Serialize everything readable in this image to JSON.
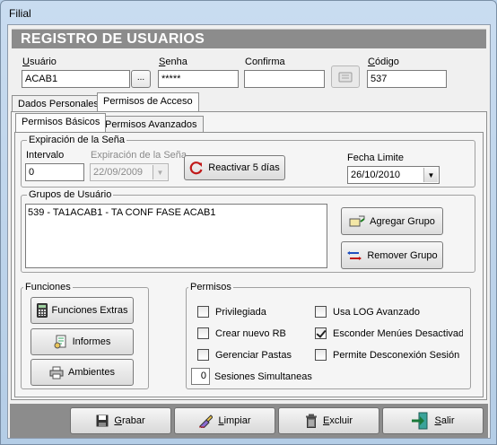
{
  "window": {
    "title": "Filial"
  },
  "header": {
    "title": "REGISTRO DE USUARIOS"
  },
  "fields": {
    "usuario": {
      "label_u": "U",
      "label_rest": "suário",
      "value": "ACAB1",
      "lookup_label": "..."
    },
    "senha": {
      "label_u": "S",
      "label_rest": "enha",
      "value": "*****"
    },
    "confirma": {
      "label": "Confirma",
      "value": ""
    },
    "codigo": {
      "label_u": "C",
      "label_rest": "ódigo",
      "value": "537"
    }
  },
  "tabs": {
    "main": [
      "Dados Personales",
      "Permisos de Acceso"
    ],
    "sub": [
      "Permisos Básicos",
      "Permisos Avanzados"
    ]
  },
  "expiracion": {
    "title": "Expiración de la Seña",
    "intervalo_label": "Intervalo",
    "intervalo_value": "0",
    "fecha_label": "Expiración de la Seña",
    "fecha_value": "22/09/2009",
    "reactivar_label": "Reactivar 5 días",
    "limite_label": "Fecha Limite",
    "limite_value": "26/10/2010"
  },
  "grupos": {
    "title": "Grupos de Usuário",
    "items": [
      "539 - TA1ACAB1 - TA CONF FASE ACAB1"
    ],
    "agregar_label": "Agregar Grupo",
    "remover_label": "Remover Grupo"
  },
  "funciones": {
    "title": "Funciones",
    "buttons": [
      "Funciones Extras",
      "Informes",
      "Ambientes"
    ]
  },
  "permisos": {
    "title": "Permisos",
    "checkboxes": [
      {
        "label": "Privilegiada",
        "checked": false
      },
      {
        "label": "Crear nuevo RB",
        "checked": false
      },
      {
        "label": "Gerenciar Pastas",
        "checked": false
      },
      {
        "label": "Usa LOG Avanzado",
        "checked": false
      },
      {
        "label": "Esconder Menúes Desactivado",
        "checked": true
      },
      {
        "label": "Permite Desconexión Sesión",
        "checked": false
      }
    ],
    "sesiones_value": "0",
    "sesiones_label": "Sesiones Simultaneas"
  },
  "footer": {
    "grabar": {
      "u": "G",
      "rest": "rabar"
    },
    "limpiar": {
      "u": "L",
      "rest": "impiar"
    },
    "excluir": {
      "u": "E",
      "rest": "xcluir"
    },
    "salir": {
      "u": "S",
      "rest": "alir"
    }
  }
}
